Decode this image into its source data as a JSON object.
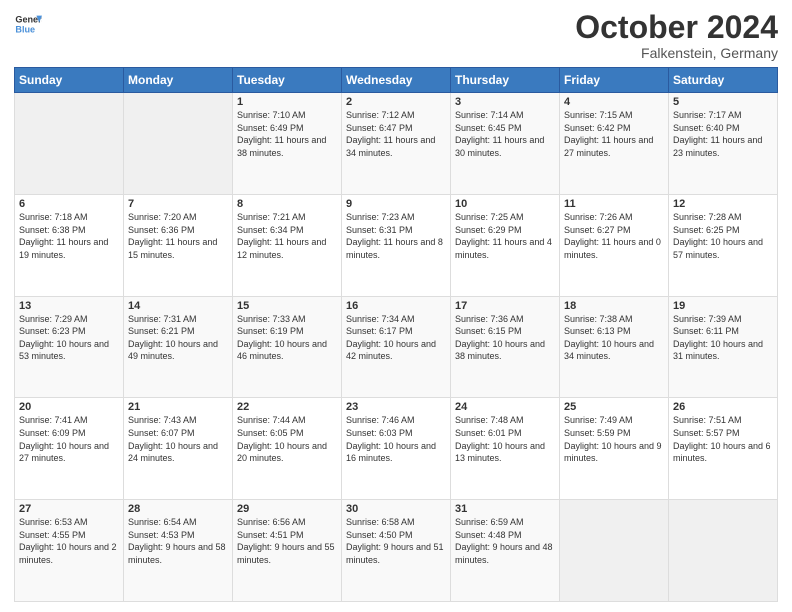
{
  "logo": {
    "line1": "General",
    "line2": "Blue"
  },
  "title": "October 2024",
  "location": "Falkenstein, Germany",
  "days_of_week": [
    "Sunday",
    "Monday",
    "Tuesday",
    "Wednesday",
    "Thursday",
    "Friday",
    "Saturday"
  ],
  "weeks": [
    [
      {
        "day": "",
        "info": ""
      },
      {
        "day": "",
        "info": ""
      },
      {
        "day": "1",
        "info": "Sunrise: 7:10 AM\nSunset: 6:49 PM\nDaylight: 11 hours and 38 minutes."
      },
      {
        "day": "2",
        "info": "Sunrise: 7:12 AM\nSunset: 6:47 PM\nDaylight: 11 hours and 34 minutes."
      },
      {
        "day": "3",
        "info": "Sunrise: 7:14 AM\nSunset: 6:45 PM\nDaylight: 11 hours and 30 minutes."
      },
      {
        "day": "4",
        "info": "Sunrise: 7:15 AM\nSunset: 6:42 PM\nDaylight: 11 hours and 27 minutes."
      },
      {
        "day": "5",
        "info": "Sunrise: 7:17 AM\nSunset: 6:40 PM\nDaylight: 11 hours and 23 minutes."
      }
    ],
    [
      {
        "day": "6",
        "info": "Sunrise: 7:18 AM\nSunset: 6:38 PM\nDaylight: 11 hours and 19 minutes."
      },
      {
        "day": "7",
        "info": "Sunrise: 7:20 AM\nSunset: 6:36 PM\nDaylight: 11 hours and 15 minutes."
      },
      {
        "day": "8",
        "info": "Sunrise: 7:21 AM\nSunset: 6:34 PM\nDaylight: 11 hours and 12 minutes."
      },
      {
        "day": "9",
        "info": "Sunrise: 7:23 AM\nSunset: 6:31 PM\nDaylight: 11 hours and 8 minutes."
      },
      {
        "day": "10",
        "info": "Sunrise: 7:25 AM\nSunset: 6:29 PM\nDaylight: 11 hours and 4 minutes."
      },
      {
        "day": "11",
        "info": "Sunrise: 7:26 AM\nSunset: 6:27 PM\nDaylight: 11 hours and 0 minutes."
      },
      {
        "day": "12",
        "info": "Sunrise: 7:28 AM\nSunset: 6:25 PM\nDaylight: 10 hours and 57 minutes."
      }
    ],
    [
      {
        "day": "13",
        "info": "Sunrise: 7:29 AM\nSunset: 6:23 PM\nDaylight: 10 hours and 53 minutes."
      },
      {
        "day": "14",
        "info": "Sunrise: 7:31 AM\nSunset: 6:21 PM\nDaylight: 10 hours and 49 minutes."
      },
      {
        "day": "15",
        "info": "Sunrise: 7:33 AM\nSunset: 6:19 PM\nDaylight: 10 hours and 46 minutes."
      },
      {
        "day": "16",
        "info": "Sunrise: 7:34 AM\nSunset: 6:17 PM\nDaylight: 10 hours and 42 minutes."
      },
      {
        "day": "17",
        "info": "Sunrise: 7:36 AM\nSunset: 6:15 PM\nDaylight: 10 hours and 38 minutes."
      },
      {
        "day": "18",
        "info": "Sunrise: 7:38 AM\nSunset: 6:13 PM\nDaylight: 10 hours and 34 minutes."
      },
      {
        "day": "19",
        "info": "Sunrise: 7:39 AM\nSunset: 6:11 PM\nDaylight: 10 hours and 31 minutes."
      }
    ],
    [
      {
        "day": "20",
        "info": "Sunrise: 7:41 AM\nSunset: 6:09 PM\nDaylight: 10 hours and 27 minutes."
      },
      {
        "day": "21",
        "info": "Sunrise: 7:43 AM\nSunset: 6:07 PM\nDaylight: 10 hours and 24 minutes."
      },
      {
        "day": "22",
        "info": "Sunrise: 7:44 AM\nSunset: 6:05 PM\nDaylight: 10 hours and 20 minutes."
      },
      {
        "day": "23",
        "info": "Sunrise: 7:46 AM\nSunset: 6:03 PM\nDaylight: 10 hours and 16 minutes."
      },
      {
        "day": "24",
        "info": "Sunrise: 7:48 AM\nSunset: 6:01 PM\nDaylight: 10 hours and 13 minutes."
      },
      {
        "day": "25",
        "info": "Sunrise: 7:49 AM\nSunset: 5:59 PM\nDaylight: 10 hours and 9 minutes."
      },
      {
        "day": "26",
        "info": "Sunrise: 7:51 AM\nSunset: 5:57 PM\nDaylight: 10 hours and 6 minutes."
      }
    ],
    [
      {
        "day": "27",
        "info": "Sunrise: 6:53 AM\nSunset: 4:55 PM\nDaylight: 10 hours and 2 minutes."
      },
      {
        "day": "28",
        "info": "Sunrise: 6:54 AM\nSunset: 4:53 PM\nDaylight: 9 hours and 58 minutes."
      },
      {
        "day": "29",
        "info": "Sunrise: 6:56 AM\nSunset: 4:51 PM\nDaylight: 9 hours and 55 minutes."
      },
      {
        "day": "30",
        "info": "Sunrise: 6:58 AM\nSunset: 4:50 PM\nDaylight: 9 hours and 51 minutes."
      },
      {
        "day": "31",
        "info": "Sunrise: 6:59 AM\nSunset: 4:48 PM\nDaylight: 9 hours and 48 minutes."
      },
      {
        "day": "",
        "info": ""
      },
      {
        "day": "",
        "info": ""
      }
    ]
  ]
}
